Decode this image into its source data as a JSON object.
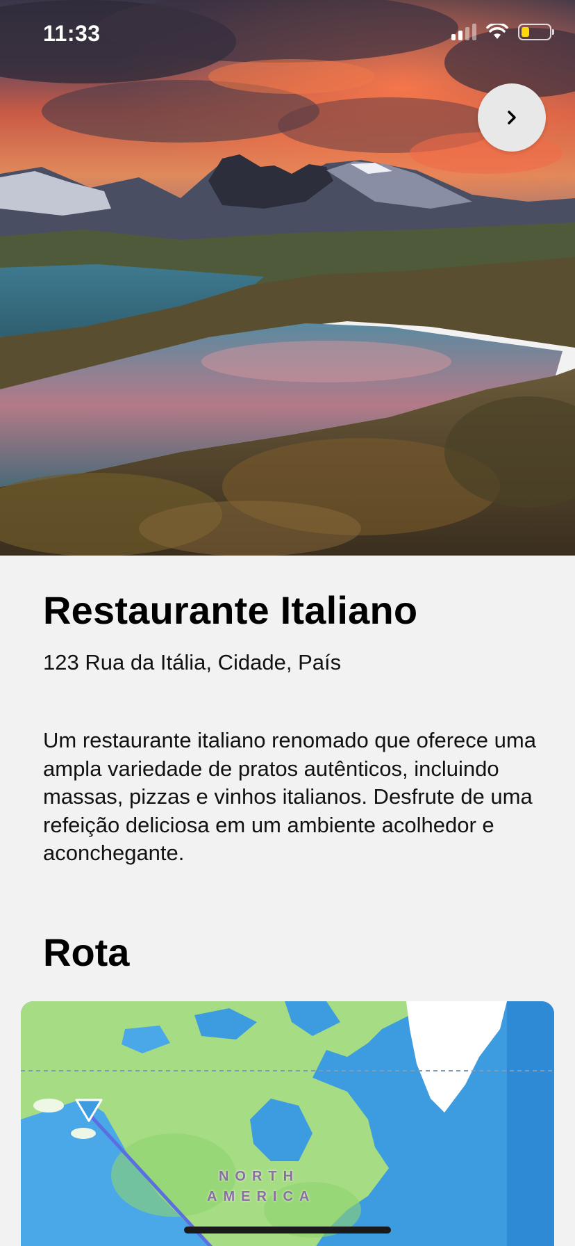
{
  "status_bar": {
    "time": "11:33"
  },
  "hero": {
    "next_icon": "chevron-right-icon"
  },
  "restaurant": {
    "name": "Restaurante Italiano",
    "address": "123 Rua da Itália, Cidade, País",
    "description": "Um restaurante italiano renomado que oferece uma ampla variedade de pratos autênticos, incluindo massas, pizzas e vinhos italianos. Desfrute de uma refeição deliciosa em um ambiente acolhedor e aconchegante."
  },
  "route": {
    "section_title": "Rota",
    "map_label_line1": "NORTH",
    "map_label_line2": "AMERICA"
  },
  "colors": {
    "background": "#f2f2f2",
    "ocean": "#3d9be0",
    "land": "#a6dd84",
    "route_line": "#5a6fe0",
    "battery": "#ffd60a"
  }
}
